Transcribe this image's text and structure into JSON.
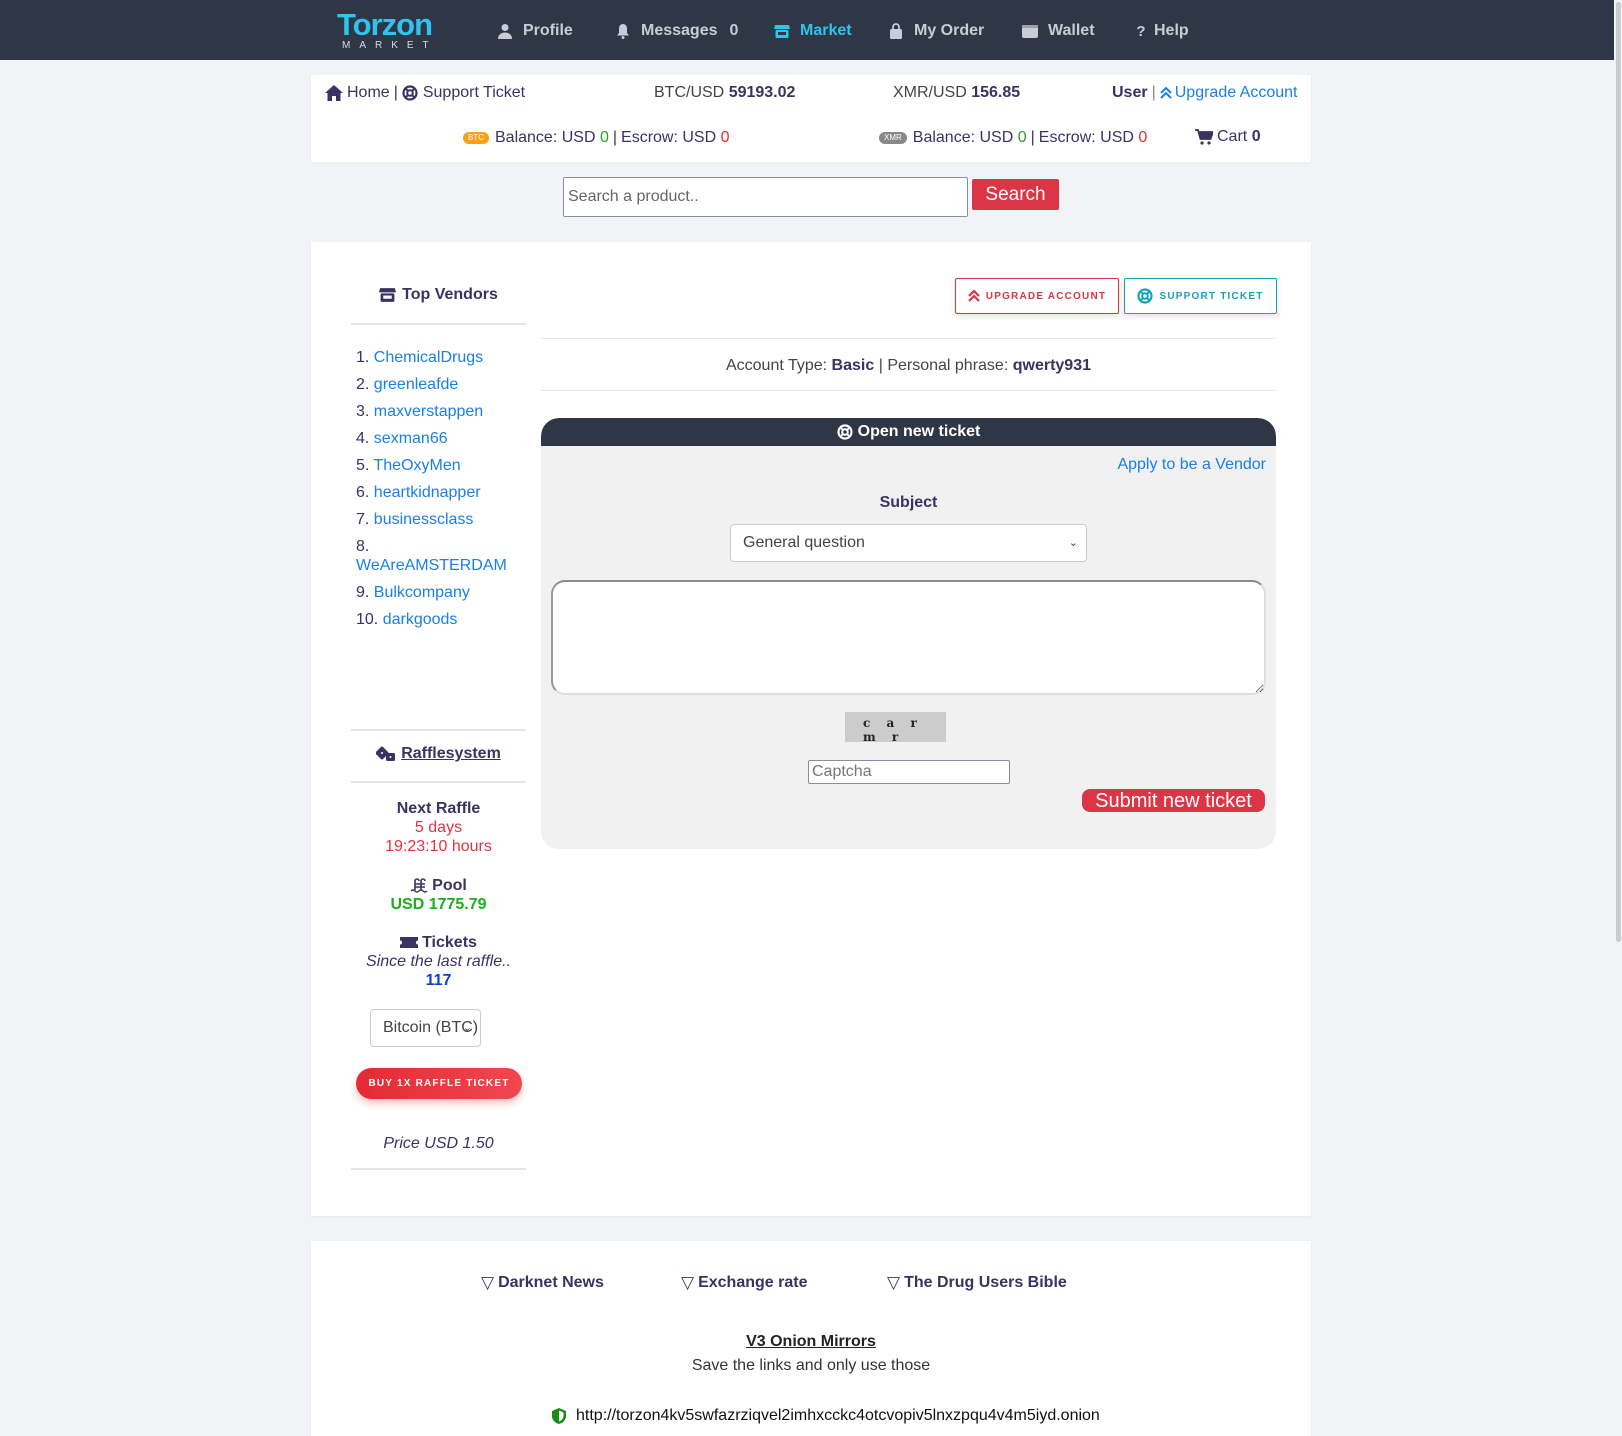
{
  "navbar": {
    "logo_word": "Torzon",
    "logo_sub": "MARKET",
    "items": [
      {
        "label": "Profile",
        "icon": "user-icon"
      },
      {
        "label": "Messages",
        "icon": "bell-icon",
        "count": "0"
      },
      {
        "label": "Market",
        "icon": "store-icon",
        "active": true
      },
      {
        "label": "My Order",
        "icon": "shopping-bag-icon"
      },
      {
        "label": "Wallet",
        "icon": "wallet-icon"
      },
      {
        "label": "Help",
        "icon": "question-icon"
      }
    ]
  },
  "info": {
    "home": "Home",
    "support_ticket": "Support Ticket",
    "btc_label": "BTC/USD",
    "btc_value": "59193.02",
    "xmr_label": "XMR/USD",
    "xmr_value": "156.85",
    "user": "User",
    "upgrade": "Upgrade Account",
    "btc_badge": "BTC",
    "xmr_badge": "XMR",
    "balance_label": "Balance: USD",
    "escrow_label": "Escrow: USD",
    "btc_balance": "0",
    "btc_escrow": "0",
    "xmr_balance": "0",
    "xmr_escrow": "0",
    "cart_label": "Cart",
    "cart_count": "0"
  },
  "search": {
    "placeholder": "Search a product..",
    "button": "Search"
  },
  "sidebar": {
    "top_vendors_title": "Top Vendors",
    "vendors": [
      {
        "num": "1.",
        "name": "ChemicalDrugs"
      },
      {
        "num": "2.",
        "name": "greenleafde"
      },
      {
        "num": "3.",
        "name": "maxverstappen"
      },
      {
        "num": "4.",
        "name": "sexman66"
      },
      {
        "num": "5.",
        "name": "TheOxyMen"
      },
      {
        "num": "6.",
        "name": "heartkidnapper"
      },
      {
        "num": "7.",
        "name": "businessclass"
      },
      {
        "num": "8.",
        "name": "WeAreAMSTERDAM"
      },
      {
        "num": "9.",
        "name": "Bulkcompany"
      },
      {
        "num": "10.",
        "name": "darkgoods"
      }
    ],
    "raffle": {
      "title": "Rafflesystem",
      "next_label": "Next Raffle",
      "next_days": "5 days",
      "next_time": "19:23:10 hours",
      "pool_label": "Pool",
      "pool_value": "USD 1775.79",
      "tickets_label": "Tickets",
      "tickets_since": "Since the last raffle..",
      "tickets_count": "117",
      "currency_selected": "Bitcoin (BTC)",
      "buy_button": "BUY 1X RAFFLE TICKET",
      "price": "Price USD 1.50"
    }
  },
  "content": {
    "upgrade_button": "UPGRADE ACCOUNT",
    "support_button": "SUPPORT TICKET",
    "account_type_label": "Account Type:",
    "account_type": "Basic",
    "phrase_label": "Personal phrase:",
    "phrase": "qwerty931",
    "ticket": {
      "title": "Open new ticket",
      "apply_link": "Apply to be a Vendor",
      "subject_label": "Subject",
      "subject_selected": "General question",
      "message_value": "",
      "captcha_text": "c a r m r",
      "captcha_placeholder": "Captcha",
      "submit": "Submit new ticket"
    }
  },
  "footer": {
    "links": [
      "Darknet News",
      "Exchange rate",
      "The Drug Users Bible"
    ],
    "mirrors_title": "V3 Onion Mirrors",
    "mirrors_sub": "Save the links and only use those",
    "mirror_url": "http://torzon4kv5swfazrziqvel2imhxcckc4otcvopiv5lnxzpqu4v4m5iyd.onion"
  }
}
